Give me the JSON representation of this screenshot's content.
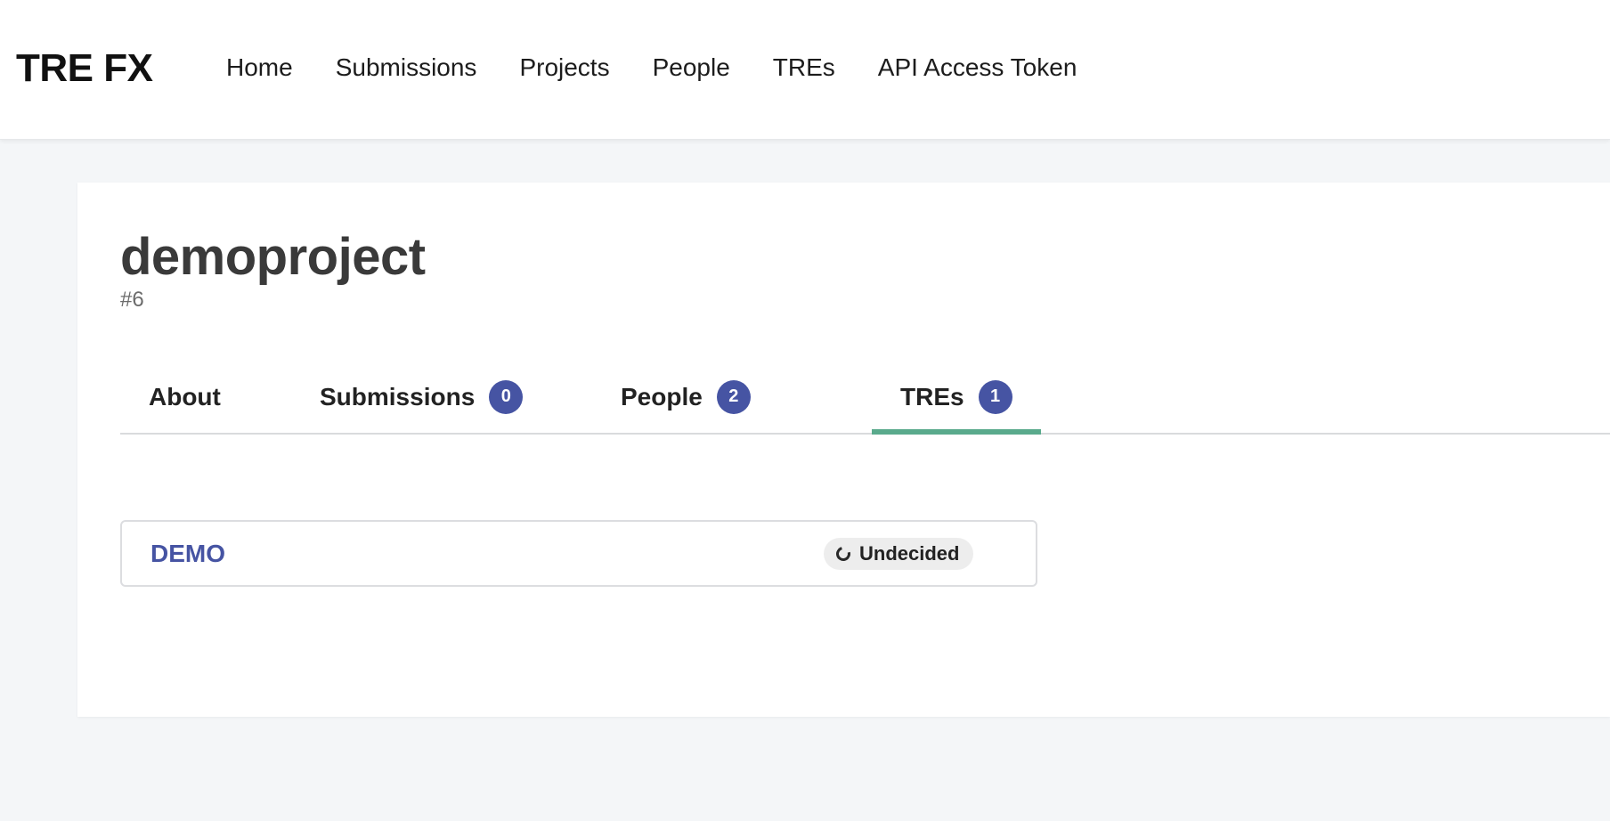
{
  "app": {
    "brand": "TRE FX"
  },
  "nav": {
    "items": [
      {
        "label": "Home"
      },
      {
        "label": "Submissions"
      },
      {
        "label": "Projects"
      },
      {
        "label": "People"
      },
      {
        "label": "TREs"
      },
      {
        "label": "API Access Token"
      }
    ]
  },
  "project": {
    "name": "demoproject",
    "id": "#6"
  },
  "tabs": [
    {
      "label": "About",
      "count": null,
      "active": false
    },
    {
      "label": "Submissions",
      "count": "0",
      "active": false
    },
    {
      "label": "People",
      "count": "2",
      "active": false
    },
    {
      "label": "TREs",
      "count": "1",
      "active": true
    }
  ],
  "tres": [
    {
      "name": "DEMO",
      "status": "Undecided",
      "status_icon": "circle-notch-icon"
    }
  ],
  "colors": {
    "accent": "#4654a3",
    "active_tab_underline": "#5aaa8c",
    "page_background": "#f4f6f8"
  }
}
